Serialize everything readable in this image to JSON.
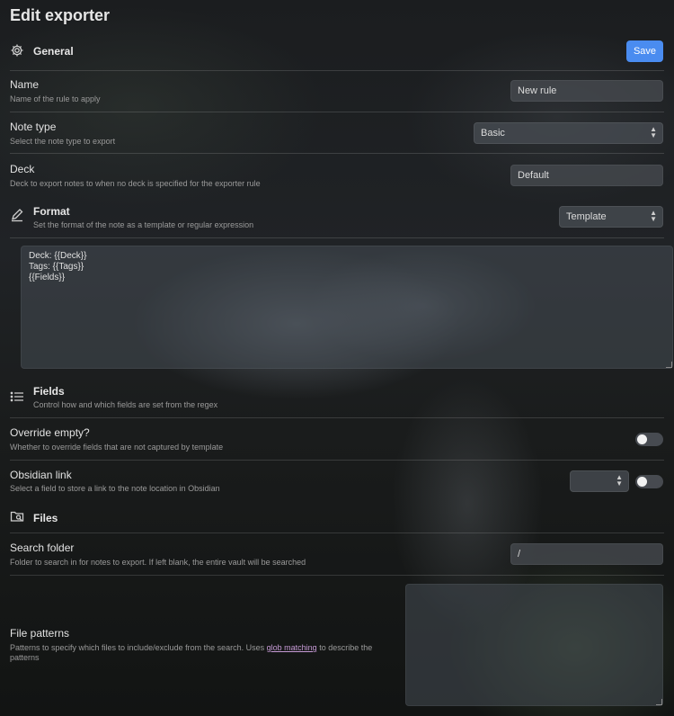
{
  "header": {
    "title": "Edit exporter"
  },
  "general": {
    "title": "General",
    "icon": "gear-icon",
    "save_label": "Save"
  },
  "name": {
    "label": "Name",
    "desc": "Name of the rule to apply",
    "value": "New rule"
  },
  "note_type": {
    "label": "Note type",
    "desc": "Select the note type to export",
    "value": "Basic"
  },
  "deck": {
    "label": "Deck",
    "desc": "Deck to export notes to when no deck is specified for the exporter rule",
    "value": "Default"
  },
  "format": {
    "title": "Format",
    "icon": "pencil-icon",
    "desc": "Set the format of the note as a template or regular expression",
    "value": "Template",
    "template_text": "Deck: {{Deck}}\nTags: {{Tags}}\n{{Fields}}"
  },
  "fields": {
    "title": "Fields",
    "icon": "list-icon",
    "desc": "Control how and which fields are set from the regex"
  },
  "override_empty": {
    "label": "Override empty?",
    "desc": "Whether to override fields that are not captured by template",
    "enabled": false
  },
  "obsidian_link": {
    "label": "Obsidian link",
    "desc": "Select a field to store a link to the note location in Obsidian",
    "value": "",
    "enabled": false
  },
  "files": {
    "title": "Files",
    "icon": "folder-search-icon"
  },
  "search_folder": {
    "label": "Search folder",
    "desc": "Folder to search in for notes to export. If left blank, the entire vault will be searched",
    "value": "/"
  },
  "file_patterns": {
    "label": "File patterns",
    "desc_prefix": "Patterns to specify which files to include/exclude from the search. Uses ",
    "desc_link": "glob matching",
    "desc_suffix": " to describe the patterns",
    "value": ""
  }
}
